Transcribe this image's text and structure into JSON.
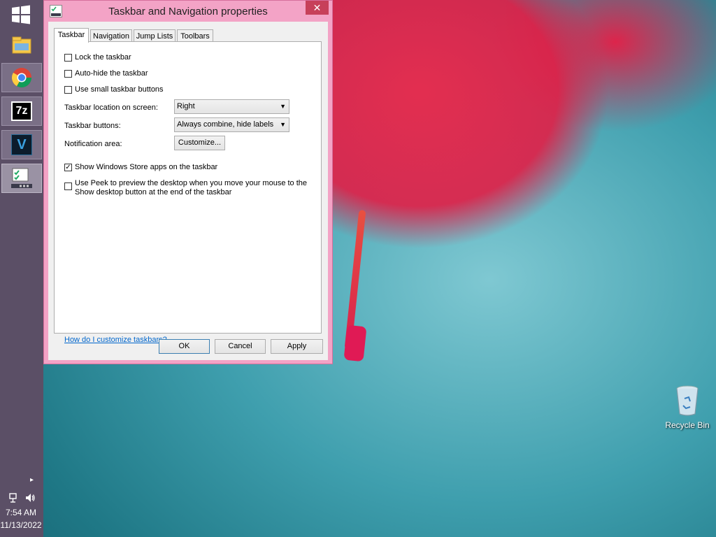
{
  "dialog": {
    "title": "Taskbar and Navigation properties",
    "close_label": "✕",
    "tabs": [
      {
        "label": "Taskbar"
      },
      {
        "label": "Navigation"
      },
      {
        "label": "Jump Lists"
      },
      {
        "label": "Toolbars"
      }
    ],
    "checkboxes": {
      "lock": {
        "label": "Lock the taskbar",
        "checked": false
      },
      "autohide": {
        "label": "Auto-hide the taskbar",
        "checked": false
      },
      "small": {
        "label": "Use small taskbar buttons",
        "checked": false
      },
      "store_apps": {
        "label": "Show Windows Store apps on the taskbar",
        "checked": true
      },
      "peek_line1": "Use Peek to preview the desktop when you move your mouse to the",
      "peek_line2": "Show desktop button at the end of the taskbar",
      "peek_checked": false
    },
    "location": {
      "label": "Taskbar location on screen:",
      "value": "Right"
    },
    "buttons_setting": {
      "label": "Taskbar buttons:",
      "value": "Always combine, hide labels"
    },
    "notification": {
      "label": "Notification area:",
      "button": "Customize..."
    },
    "help_link": "How do I customize taskbars?",
    "ok": "OK",
    "cancel": "Cancel",
    "apply": "Apply",
    "check_mark": "✓"
  },
  "taskbar": {
    "apps": [
      {
        "icon": "file-explorer-icon"
      },
      {
        "icon": "chrome-icon"
      },
      {
        "icon": "7zip-icon",
        "label": "7z"
      },
      {
        "icon": "vegas-icon",
        "label": "V"
      },
      {
        "icon": "taskbar-properties-icon"
      }
    ],
    "clock_time": "7:54 AM",
    "clock_date": "11/13/2022",
    "tray_arrow": "▸"
  },
  "desktop": {
    "recycle_bin_label": "Recycle Bin"
  },
  "colors": {
    "taskbar": "#5b4f66",
    "dialog_frame": "#f3a3c6",
    "close_button": "#c7405a"
  }
}
